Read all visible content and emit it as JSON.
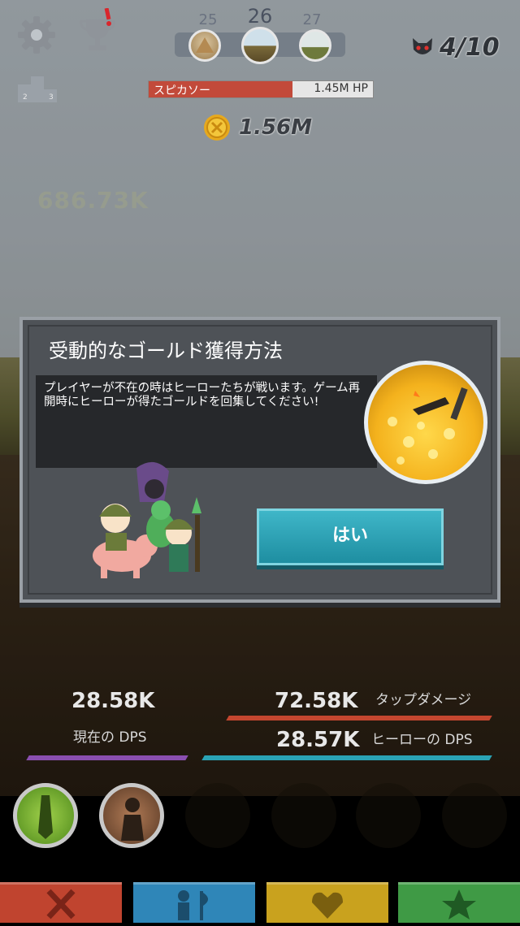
{
  "hud": {
    "stages": [
      {
        "number": "25",
        "current": false
      },
      {
        "number": "26",
        "current": true
      },
      {
        "number": "27",
        "current": false
      }
    ],
    "boss_counter": "4/10",
    "enemy": {
      "name": "スピカソー",
      "hp": "1.45M HP",
      "hp_fraction": 0.64
    },
    "gold": "1.56M",
    "floating_damage": "686.73K"
  },
  "dialog": {
    "title": "受動的なゴールド獲得方法",
    "message": "プレイヤーが不在の時はヒーローたちが戦います。ゲーム再開時にヒーローが得たゴールドを回集してください!",
    "yes_label": "はい"
  },
  "stats": {
    "current_dps_value": "28.58K",
    "current_dps_label": "現在の DPS",
    "tap_damage_value": "72.58K",
    "tap_damage_label": "タップダメージ",
    "hero_dps_value": "28.57K",
    "hero_dps_label": "ヒーローの DPS"
  },
  "colors": {
    "tab_attack": "#c0442f",
    "tab_heroes": "#2f86b8",
    "tab_artifacts": "#c9a21e",
    "tab_shop": "#3f9a45",
    "accent_teal": "#2aa3b5",
    "bar_purple": "#8a4fb0",
    "bar_red": "#c4462f"
  },
  "icons": {
    "settings": "gear-icon",
    "achievements": "trophy-icon",
    "leaderboard": "podium-icon",
    "boss": "demon-icon",
    "coin": "coin-icon"
  }
}
